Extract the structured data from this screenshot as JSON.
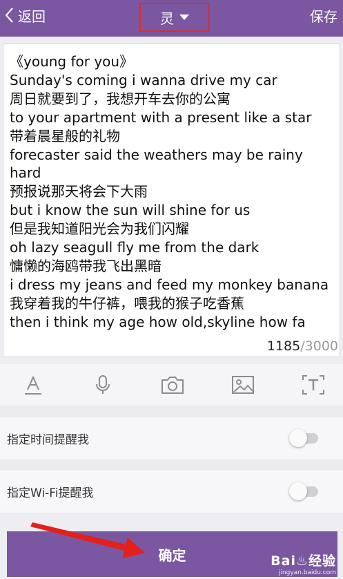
{
  "header": {
    "back_label": "返回",
    "title": "灵",
    "save_label": "保存"
  },
  "editor": {
    "lines": [
      "《young for you》",
      "Sunday's coming i wanna drive my car",
      "周日就要到了，我想开车去你的公寓",
      "to your apartment with a present like a star",
      "带着晨星般的礼物",
      "forecaster said the weathers may be rainy",
      "hard",
      "预报说那天将会下大雨",
      "but i know the sun will shine for us",
      "但是我知道阳光会为我们闪耀",
      "oh lazy seagull fly me from the dark",
      "慵懒的海鸥带我飞出黑暗",
      "i dress my jeans and feed my monkey banana",
      "我穿着我的牛仔裤，喂我的猴子吃香蕉",
      "then i think my age how old,skyline how fa"
    ],
    "count": "1185",
    "max": "/3000"
  },
  "toolbar": {
    "icons": [
      "text-format-icon",
      "microphone-icon",
      "camera-icon",
      "image-icon",
      "text-box-icon"
    ]
  },
  "settings": {
    "time_reminder_label": "指定时间提醒我",
    "time_reminder_on": false,
    "wifi_reminder_label": "指定Wi-Fi提醒我",
    "wifi_reminder_on": false
  },
  "confirm_label": "确定",
  "watermark": {
    "main": "Bai♨经验",
    "sub": "jingyan.baidu.com"
  },
  "colors": {
    "accent": "#7a57a0",
    "highlight": "#e02a2a"
  }
}
